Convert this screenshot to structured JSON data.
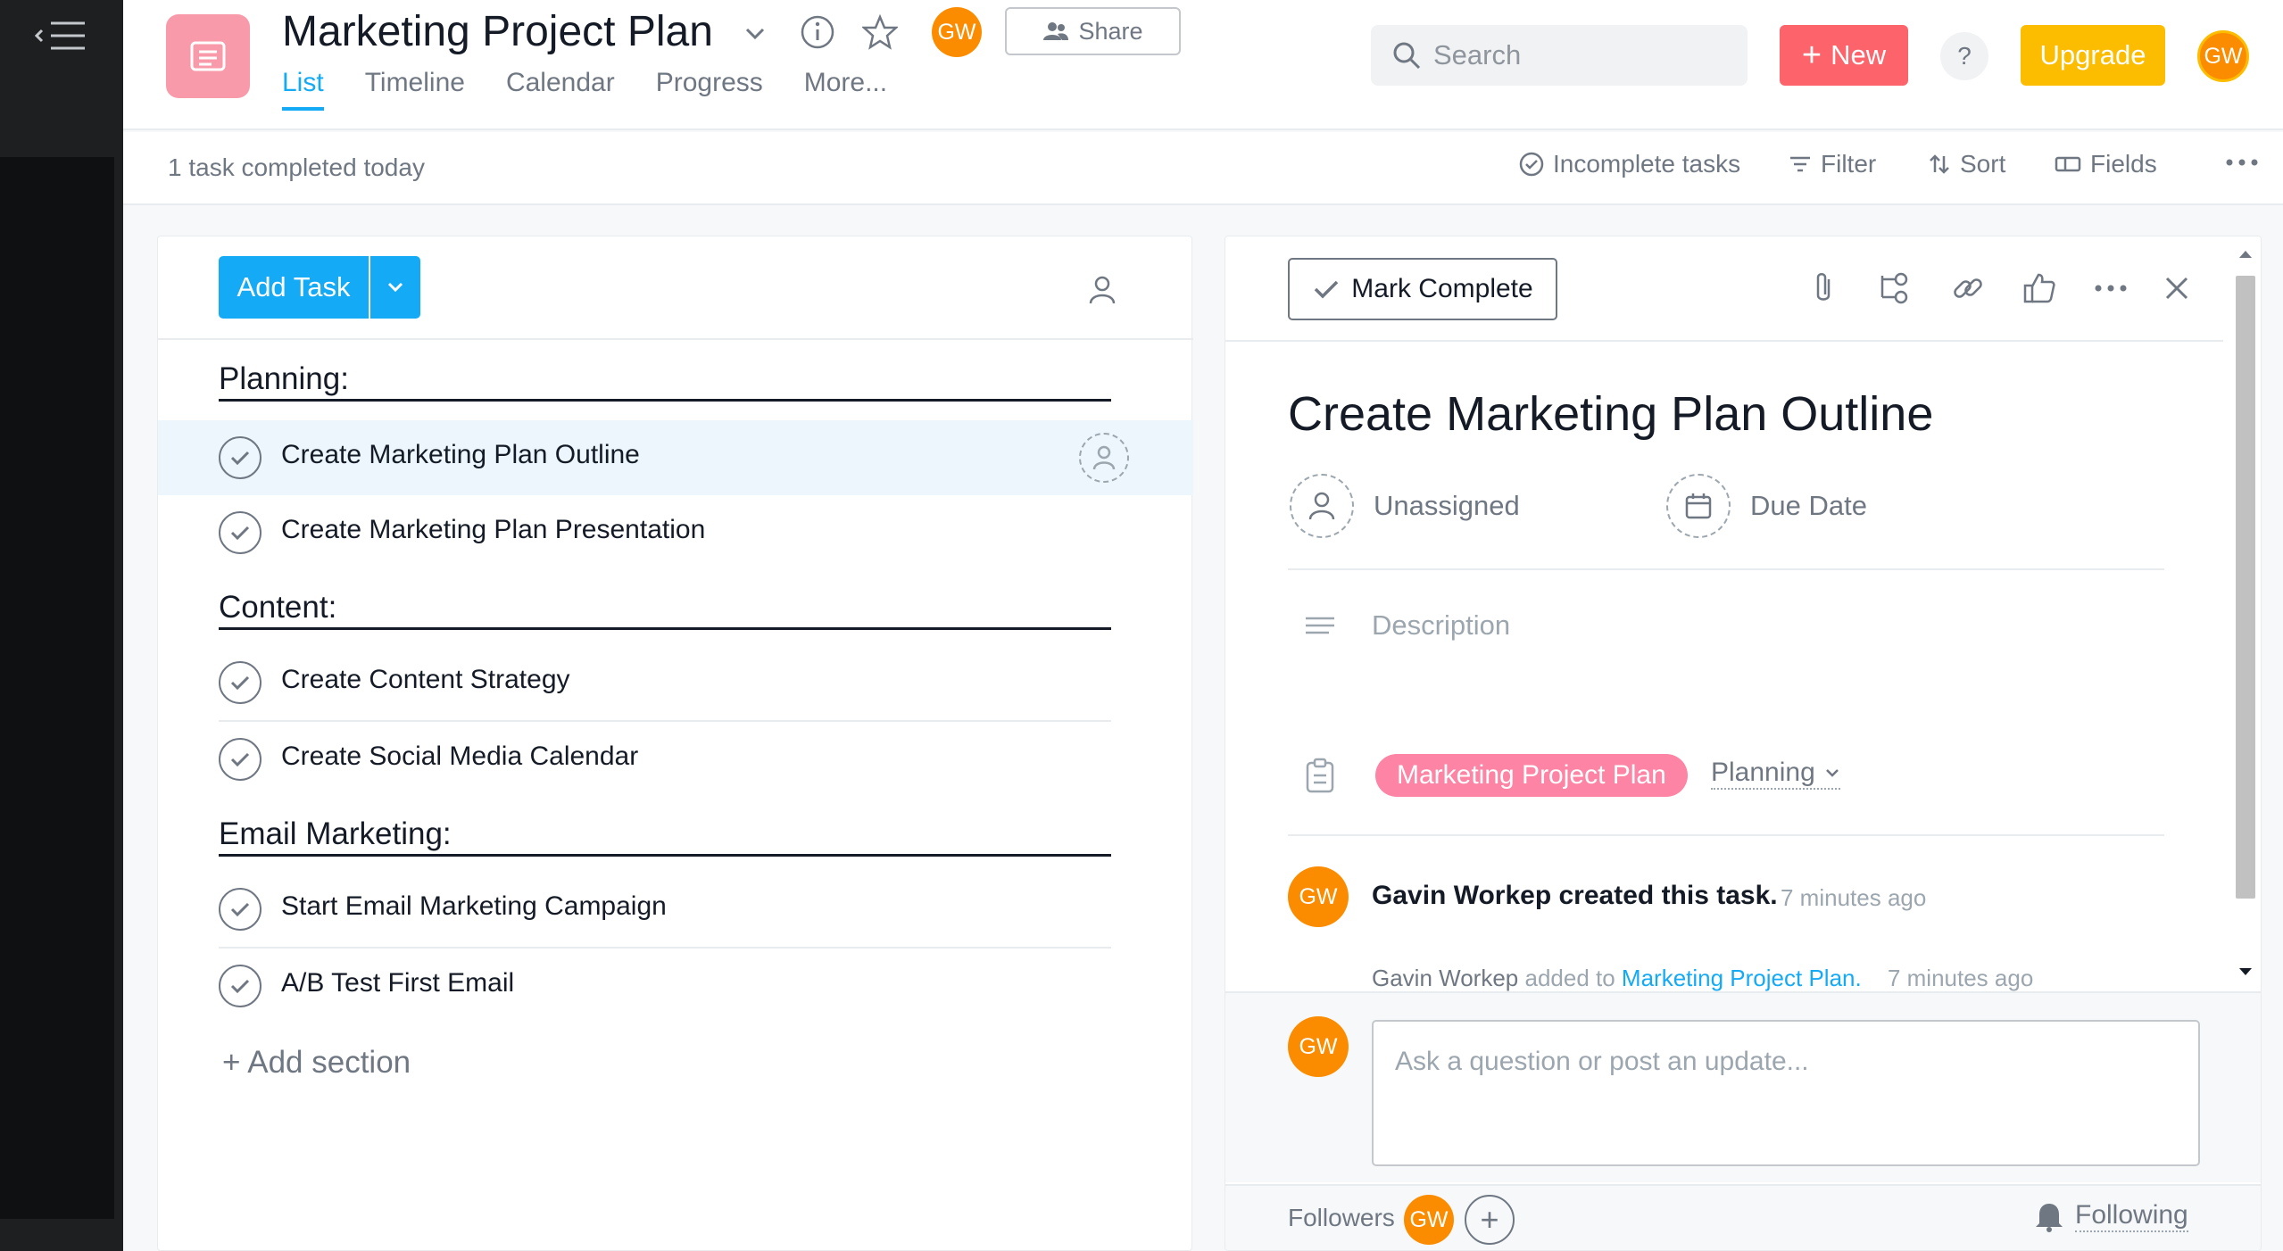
{
  "project": {
    "title": "Marketing Project Plan",
    "share_label": "Share",
    "avatar_initials": "GW"
  },
  "tabs": [
    {
      "label": "List",
      "active": true
    },
    {
      "label": "Timeline",
      "active": false
    },
    {
      "label": "Calendar",
      "active": false
    },
    {
      "label": "Progress",
      "active": false
    },
    {
      "label": "More...",
      "active": false
    }
  ],
  "search": {
    "placeholder": "Search"
  },
  "header_buttons": {
    "new_label": "New",
    "help_label": "?",
    "upgrade_label": "Upgrade",
    "user_initials": "GW"
  },
  "subbar": {
    "completed_text": "1 task completed today",
    "incomplete_label": "Incomplete tasks",
    "filter_label": "Filter",
    "sort_label": "Sort",
    "fields_label": "Fields"
  },
  "list": {
    "add_task_label": "Add Task",
    "sections": [
      {
        "title": "Planning:",
        "tasks": [
          "Create Marketing Plan Outline",
          "Create Marketing Plan Presentation"
        ]
      },
      {
        "title": "Content:",
        "tasks": [
          "Create Content Strategy",
          "Create Social Media Calendar"
        ]
      },
      {
        "title": "Email Marketing:",
        "tasks": [
          "Start Email Marketing Campaign",
          "A/B Test First Email"
        ]
      }
    ],
    "add_section_label": "+ Add section"
  },
  "detail": {
    "mark_complete_label": "Mark Complete",
    "task_title": "Create Marketing Plan Outline",
    "assignee_label": "Unassigned",
    "due_date_label": "Due Date",
    "description_placeholder": "Description",
    "project_pill": "Marketing Project Plan",
    "section_label": "Planning",
    "story": {
      "author_initials": "GW",
      "created_text": "Gavin Workep created this task.",
      "created_time": "7 minutes ago",
      "added_who": "Gavin Workep",
      "added_text": " added to ",
      "added_project": "Marketing Project Plan.",
      "added_time": "7 minutes ago"
    },
    "composer_initials": "GW",
    "composer_placeholder": "Ask a question or post an update...",
    "followers_label": "Followers",
    "follower_initials": "GW",
    "following_label": "Following"
  },
  "colors": {
    "accent_blue": "#14aaf5",
    "new_red": "#fc636b",
    "upgrade_yellow": "#fcbd01",
    "avatar_orange": "#fb8c00",
    "project_pink": "#fd84a4"
  }
}
